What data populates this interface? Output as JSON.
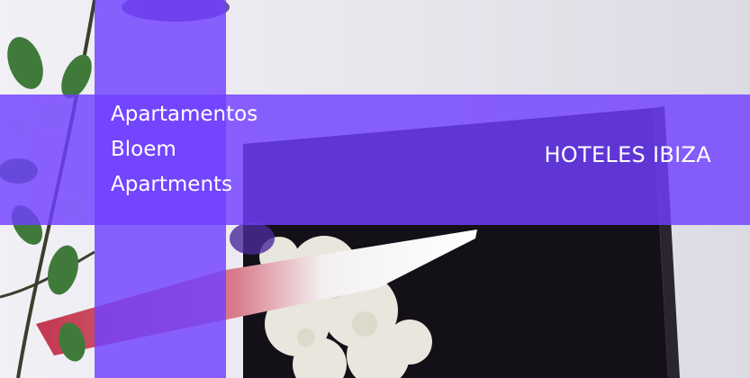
{
  "hotel": {
    "name_lines": [
      "Apartamentos",
      "Bloem",
      "Apartments"
    ]
  },
  "category_label": "HOTELES IBIZA",
  "colors": {
    "overlay": "#7040ff",
    "text": "#ffffff"
  }
}
